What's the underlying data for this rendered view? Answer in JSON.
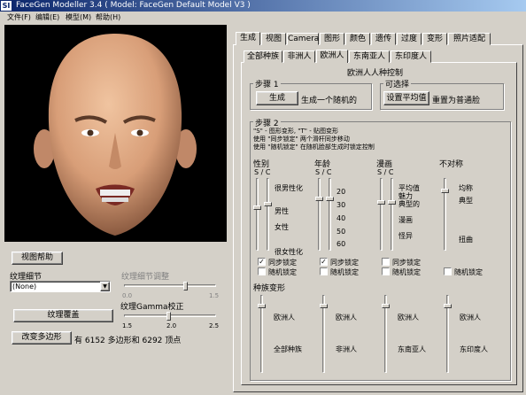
{
  "window": {
    "icon": "SI",
    "title": "FaceGen Modeller 3.4  ( Model: FaceGen Default Model V3 )"
  },
  "menu": [
    "文件(F)",
    "编辑(E)",
    "模型(M)",
    "帮助(H)"
  ],
  "left": {
    "view_help": "视图帮助",
    "texture_detail_label": "纹理细节",
    "texture_detail_value": "(None)",
    "texture_detail_adjust": "纹理细节调整",
    "tda_min": "0.0",
    "tda_max": "1.5",
    "texture_cover": "纹理覆盖",
    "gamma_label": "纹理Gamma校正",
    "gamma_min": "1.5",
    "gamma_mid": "2.0",
    "gamma_max": "2.5",
    "change_poly": "改变多边形",
    "poly_info": "有 6152 多边形和 6292 顶点"
  },
  "tabs": [
    "生成",
    "视图",
    "Camera",
    "图形",
    "颜色",
    "遗传",
    "过度",
    "变形",
    "照片适配"
  ],
  "subtabs": [
    "全部种族",
    "非洲人",
    "欧洲人",
    "东南亚人",
    "东印度人"
  ],
  "panel_title": "欧洲人人种控制",
  "step1": {
    "label": "步骤 1",
    "generate": "生成",
    "generate_desc": "生成一个随机的"
  },
  "optional": {
    "label": "可选择",
    "set_avg": "设置平均值",
    "reset_desc": "重置为普通脸"
  },
  "step2": {
    "label": "步骤 2",
    "note1": "\"S\" - 图形变形, \"T\" - 贴图变形",
    "note2": "使用 \"同步锁定\" 两个滑杆同步移动",
    "note3": "使用 \"随机锁定\" 在随机脸部生成时锁定控制"
  },
  "cols": [
    {
      "title": "性别",
      "sc": "S / C",
      "labels": [
        "很男性化",
        "男性",
        "女性",
        "很女性化"
      ]
    },
    {
      "title": "年龄",
      "sc": "S / C",
      "labels": [
        "20",
        "30",
        "40",
        "50",
        "60"
      ]
    },
    {
      "title": "漫画",
      "sc": "S / C",
      "labels": [
        "平均值",
        "魅力",
        "典型的",
        "漫画",
        "怪异"
      ]
    },
    {
      "title": "不对称",
      "sc": "",
      "labels": [
        "均称",
        "典型",
        "扭曲"
      ]
    }
  ],
  "sync_lock": "同步锁定",
  "random_lock": "随机锁定",
  "morph_title": "种族变形",
  "morph": [
    {
      "top": "欧洲人",
      "bottom": "全部种族"
    },
    {
      "top": "欧洲人",
      "bottom": "非洲人"
    },
    {
      "top": "欧洲人",
      "bottom": "东南亚人"
    },
    {
      "top": "欧洲人",
      "bottom": "东印度人"
    }
  ]
}
